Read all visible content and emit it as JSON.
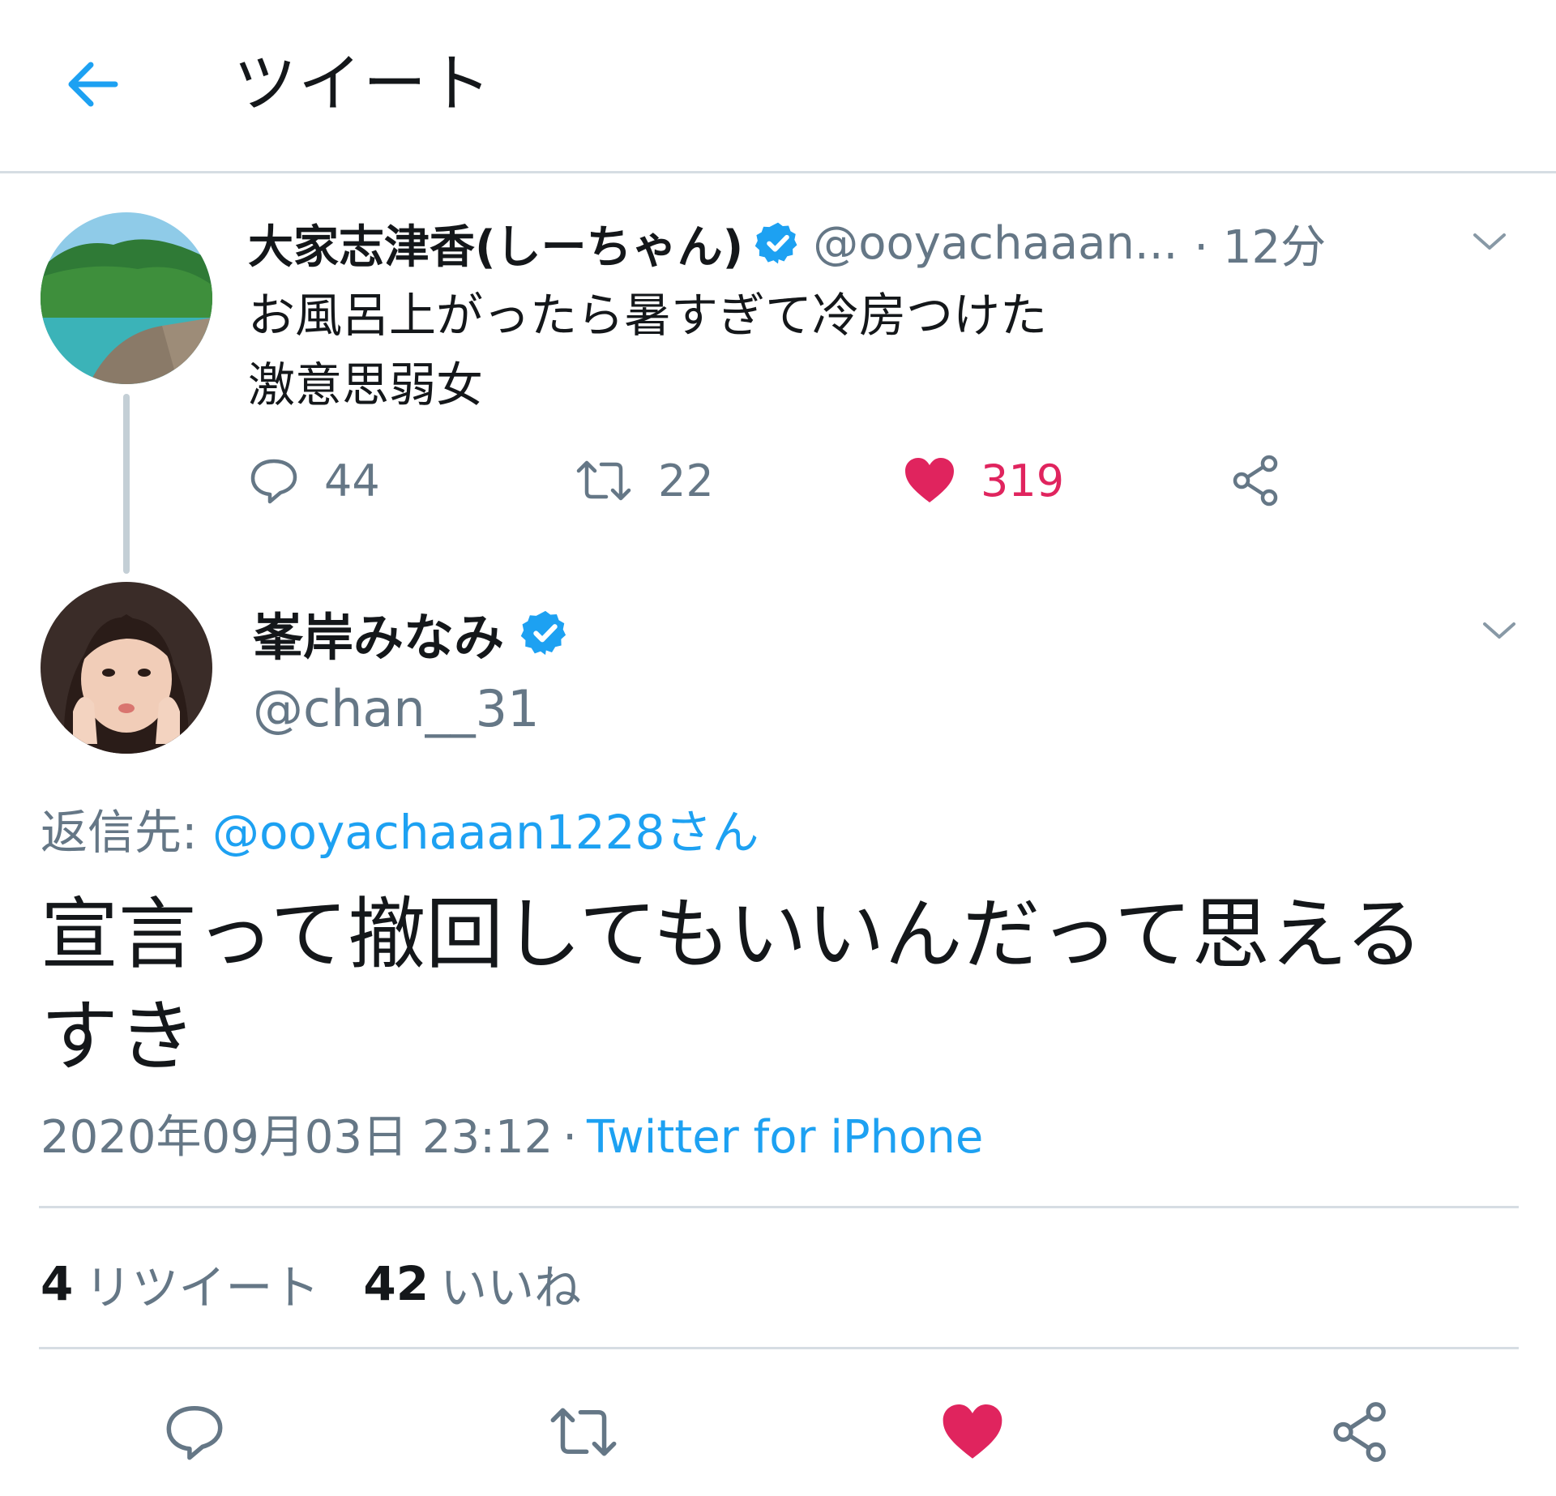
{
  "header": {
    "title": "ツイート",
    "back_icon": "arrow-left-icon",
    "accent_color": "#1da1f2"
  },
  "parent_tweet": {
    "display_name": "大家志津香(しーちゃん)",
    "verified": true,
    "handle": "@ooyachaaan...",
    "separator": "·",
    "time": "12分",
    "text": "お風呂上がったら暑すぎて冷房つけた\n激意思弱女",
    "replies": "44",
    "retweets": "22",
    "likes": "319",
    "liked": true
  },
  "main_tweet": {
    "display_name": "峯岸みなみ",
    "verified": true,
    "handle": "@chan__31",
    "reply_label": "返信先:",
    "reply_target": "@ooyachaaan1228さん",
    "text": "宣言って撤回してもいいんだって思える\nすき",
    "date": "2020年09月03日 23:12",
    "separator": "·",
    "source": "Twitter for iPhone",
    "retweet_count": "4",
    "retweet_label": "リツイート",
    "like_count": "42",
    "like_label": "いいね",
    "liked": true
  },
  "colors": {
    "text_primary": "#14171a",
    "text_secondary": "#657786",
    "link": "#1da1f2",
    "like": "#e0245e",
    "divider": "#d6dde3",
    "verified": "#1da1f2"
  }
}
